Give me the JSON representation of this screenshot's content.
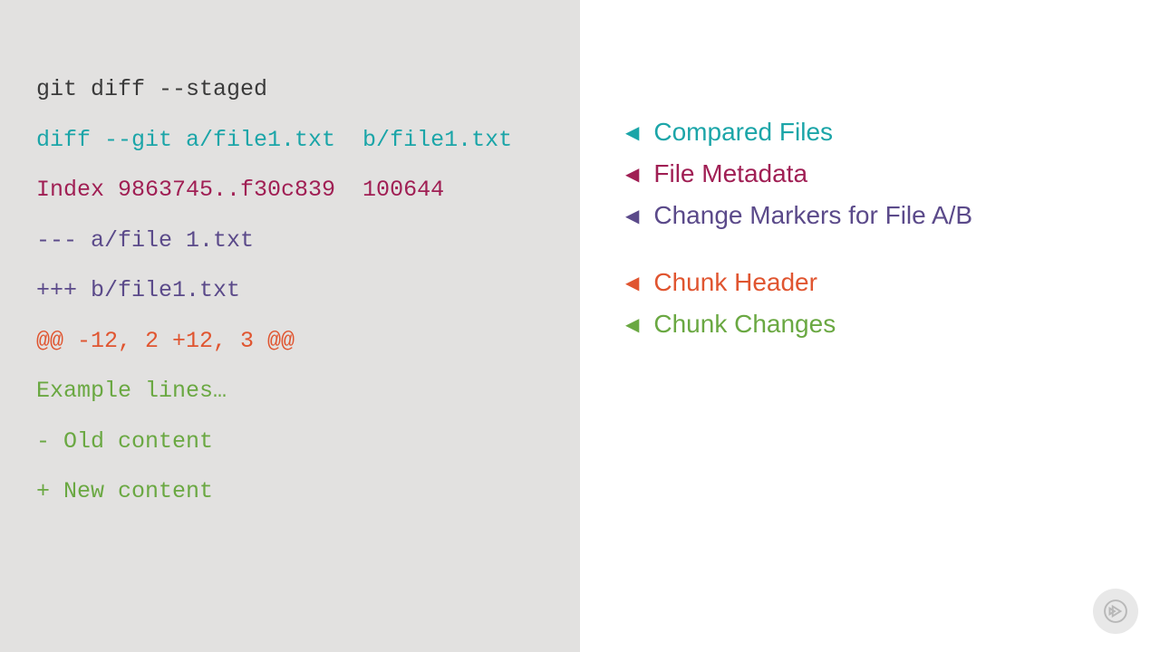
{
  "code": {
    "line1": "git diff --staged",
    "line2": "diff --git a/file1.txt  b/file1.txt",
    "line3": "Index 9863745..f30c839  100644",
    "line4": "--- a/file 1.txt",
    "line5": "+++ b/file1.txt",
    "line6": "@@ -12, 2 +12, 3 @@",
    "line7": "Example lines…",
    "line8": "- Old content",
    "line9": "+ New content"
  },
  "legend": {
    "item1": "Compared Files",
    "item2": "File Metadata",
    "item3": "Change Markers for File A/B",
    "item4": "Chunk Header",
    "item5": "Chunk Changes"
  },
  "colors": {
    "teal": "#1ba5a8",
    "maroon": "#a01f54",
    "purple": "#5b4a8a",
    "orange": "#e05530",
    "green": "#6aa842",
    "dark": "#3a3a3a"
  }
}
